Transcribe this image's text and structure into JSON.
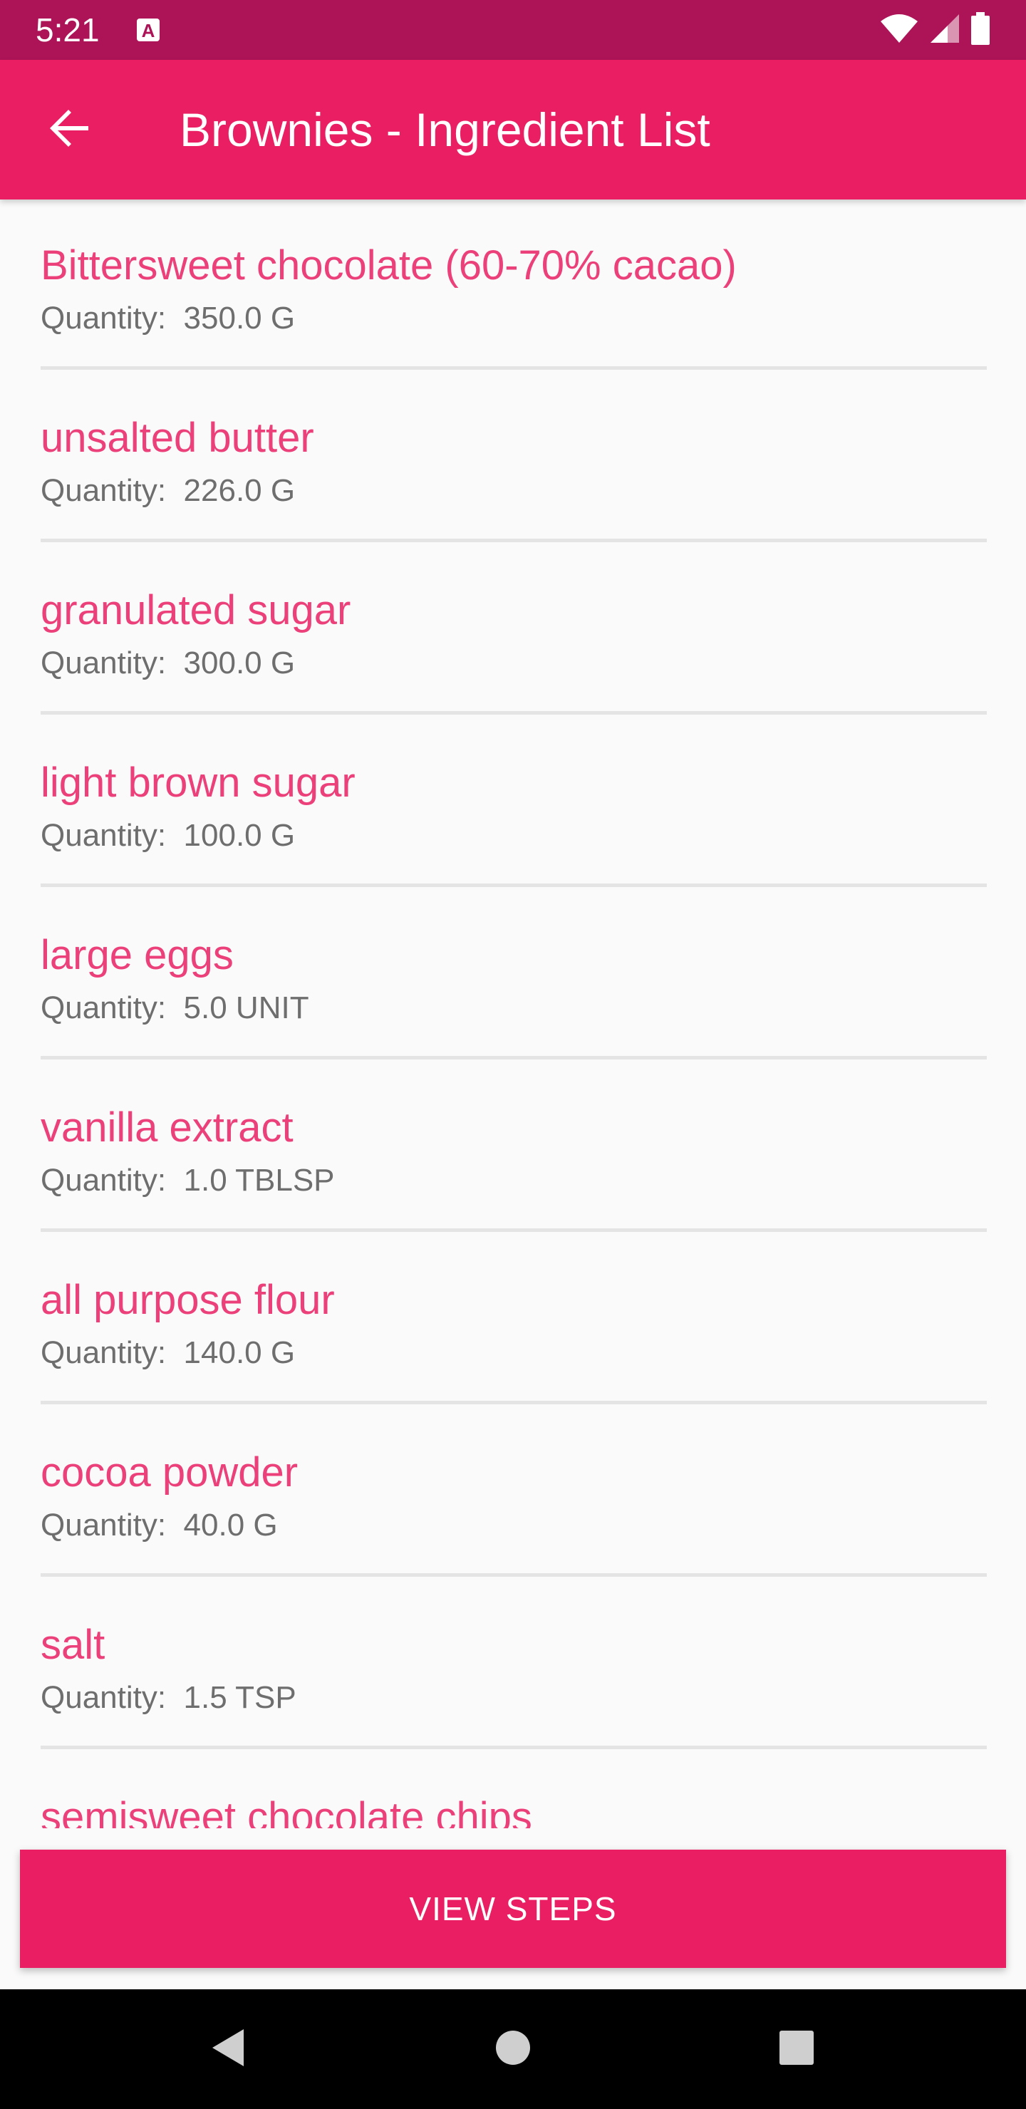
{
  "status_bar": {
    "time": "5:21",
    "notification_icon": "text-a-icon",
    "wifi_icon": "wifi-icon",
    "signal_icon": "cell-signal-icon",
    "battery_icon": "battery-icon",
    "color": "#ad1457"
  },
  "app_bar": {
    "title": "Brownies - Ingredient List",
    "back_icon": "arrow-back-icon",
    "color": "#e91e63"
  },
  "ingredients": [
    {
      "name": "Bittersweet chocolate (60-70% cacao)",
      "quantity": "Quantity:  350.0 G"
    },
    {
      "name": "unsalted butter",
      "quantity": "Quantity:  226.0 G"
    },
    {
      "name": "granulated sugar",
      "quantity": "Quantity:  300.0 G"
    },
    {
      "name": "light brown sugar",
      "quantity": "Quantity:  100.0 G"
    },
    {
      "name": "large eggs",
      "quantity": "Quantity:  5.0 UNIT"
    },
    {
      "name": "vanilla extract",
      "quantity": "Quantity:  1.0 TBLSP"
    },
    {
      "name": "all purpose flour",
      "quantity": "Quantity:  140.0 G"
    },
    {
      "name": "cocoa powder",
      "quantity": "Quantity:  40.0 G"
    },
    {
      "name": "salt",
      "quantity": "Quantity:  1.5 TSP"
    },
    {
      "name": "semisweet chocolate chips",
      "quantity": ""
    }
  ],
  "view_steps_button": {
    "label": "VIEW STEPS"
  },
  "nav_bar": {
    "back_icon": "nav-back-icon",
    "home_icon": "nav-home-icon",
    "recents_icon": "nav-recents-icon"
  },
  "colors": {
    "accent": "#e91e63",
    "ingredient_name": "#ec407a",
    "quantity_text": "#6e6e6e"
  }
}
